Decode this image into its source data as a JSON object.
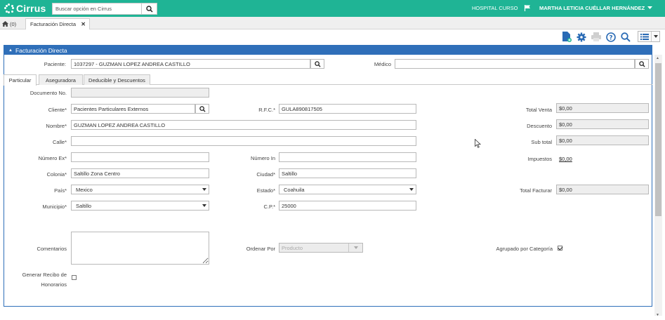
{
  "header": {
    "logo_text": "Cirrus",
    "search_placeholder": "Buscar opción en Cirrus",
    "hospital": "HOSPITAL CURSO",
    "user": "MARTHA LETICIA CUÉLLAR HERNÁNDEZ"
  },
  "tabs": {
    "home_count": "(0)",
    "active_tab": "Facturación Directa"
  },
  "toolbar": {
    "icons": [
      "add-document-icon",
      "gear-icon",
      "print-icon",
      "help-icon",
      "search-icon",
      "list-view-icon",
      "chevron-down-icon"
    ]
  },
  "panel": {
    "title": "Facturación Directa",
    "paciente_label": "Paciente:",
    "paciente_value": "1037297 - GUZMAN LOPEZ ANDREA CASTILLO",
    "medico_label": "Médico",
    "medico_value": ""
  },
  "subtabs": [
    "Particular",
    "Aseguradora",
    "Deducible y Descuentos"
  ],
  "form": {
    "documento_label": "Documento No.",
    "documento_value": "",
    "cliente_label": "Cliente*",
    "cliente_value": "Pacientes Particulares Externos",
    "rfc_label": "R.F.C.*",
    "rfc_value": "GULA890817505",
    "nombre_label": "Nombre*",
    "nombre_value": "GUZMAN LOPEZ ANDREA CASTILLO",
    "calle_label": "Calle*",
    "calle_value": "",
    "numero_ex_label": "Número Ex*",
    "numero_ex_value": "",
    "numero_in_label": "Número In",
    "numero_in_value": "",
    "colonia_label": "Colonia*",
    "colonia_value": "Saltillo Zona Centro",
    "ciudad_label": "Ciudad*",
    "ciudad_value": "Saltillo",
    "pais_label": "País*",
    "pais_value": "Mexico",
    "estado_label": "Estado*",
    "estado_value": "Coahuila",
    "municipio_label": "Municipio*",
    "municipio_value": "Saltillo",
    "cp_label": "C.P.*",
    "cp_value": "25000",
    "comentarios_label": "Comentarios",
    "ordenar_label": "Ordenar Por",
    "ordenar_value": "Producto",
    "agrupado_label": "Agrupado por Categoría",
    "agrupado_checked": true,
    "recibo_label_1": "Generar Recibo de",
    "recibo_label_2": "Honorarios",
    "recibo_checked": false
  },
  "totals": {
    "total_venta_label": "Total Venta",
    "total_venta_value": "$0,00",
    "descuento_label": "Descuento",
    "descuento_value": "$0,00",
    "subtotal_label": "Sub total",
    "subtotal_value": "$0,00",
    "impuestos_label": "Impuestos",
    "impuestos_value": "$0,00",
    "total_facturar_label": "Total Facturar",
    "total_facturar_value": "$0,00"
  },
  "colors": {
    "header_bg": "#1fb495",
    "panel_blue": "#2f6fb9",
    "icon_blue": "#2a6bb5"
  }
}
